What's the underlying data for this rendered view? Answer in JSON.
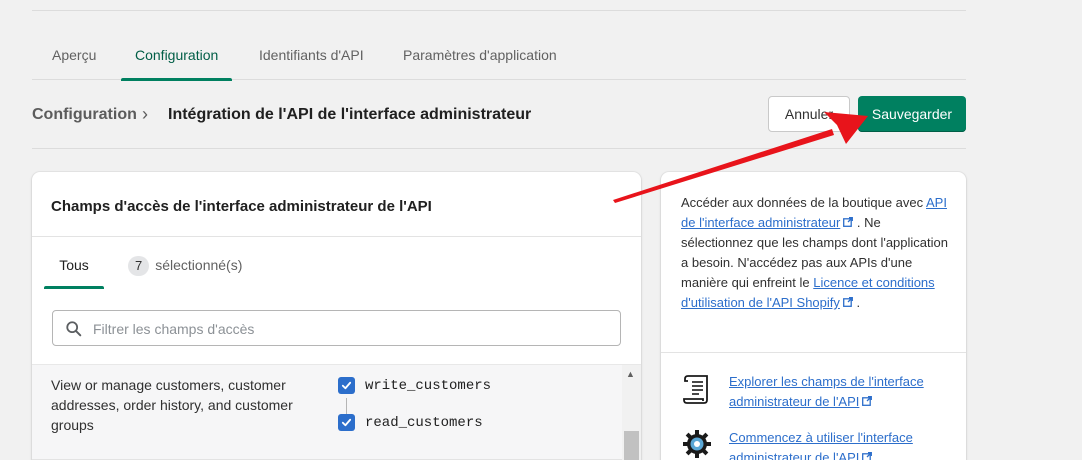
{
  "tabs": [
    {
      "label": "Aperçu",
      "active": false
    },
    {
      "label": "Configuration",
      "active": true
    },
    {
      "label": "Identifiants d'API",
      "active": false
    },
    {
      "label": "Paramètres d'application",
      "active": false
    }
  ],
  "header": {
    "breadcrumb_root": "Configuration",
    "breadcrumb_separator": "›",
    "title": "Intégration de l'API de l'interface administrateur",
    "cancel_label": "Annuler",
    "save_label": "Sauvegarder"
  },
  "access_card": {
    "title": "Champs d'accès de l'interface administrateur de l'API",
    "tab_all": "Tous",
    "selected_count": "7",
    "selected_label": "sélectionné(s)",
    "filter_placeholder": "Filtrer les champs d'accès",
    "scope_description": "View or manage customers, customer addresses, order history, and customer groups",
    "permissions": [
      {
        "label": "write_customers",
        "checked": true
      },
      {
        "label": "read_customers",
        "checked": true
      }
    ]
  },
  "info_card": {
    "text_1": "Accéder aux données de la boutique avec ",
    "link_1": "API de l'interface administrateur",
    "text_2": ". Ne sélectionnez que les champs dont l'application a besoin. N'accédez pas aux APIs d'une manière qui enfreint le ",
    "link_2": "Licence et conditions d'utilisation de l'API Shopify",
    "text_3": ".",
    "resources": [
      {
        "label": "Explorer les champs de l'interface administrateur de l'API",
        "icon": "scroll-document-icon"
      },
      {
        "label": "Commencez à utiliser l'interface administrateur de l'API",
        "icon": "gear-icon"
      }
    ]
  },
  "colors": {
    "accent": "#008060",
    "link": "#2c6ecb",
    "annotation_arrow": "#e8141b"
  }
}
